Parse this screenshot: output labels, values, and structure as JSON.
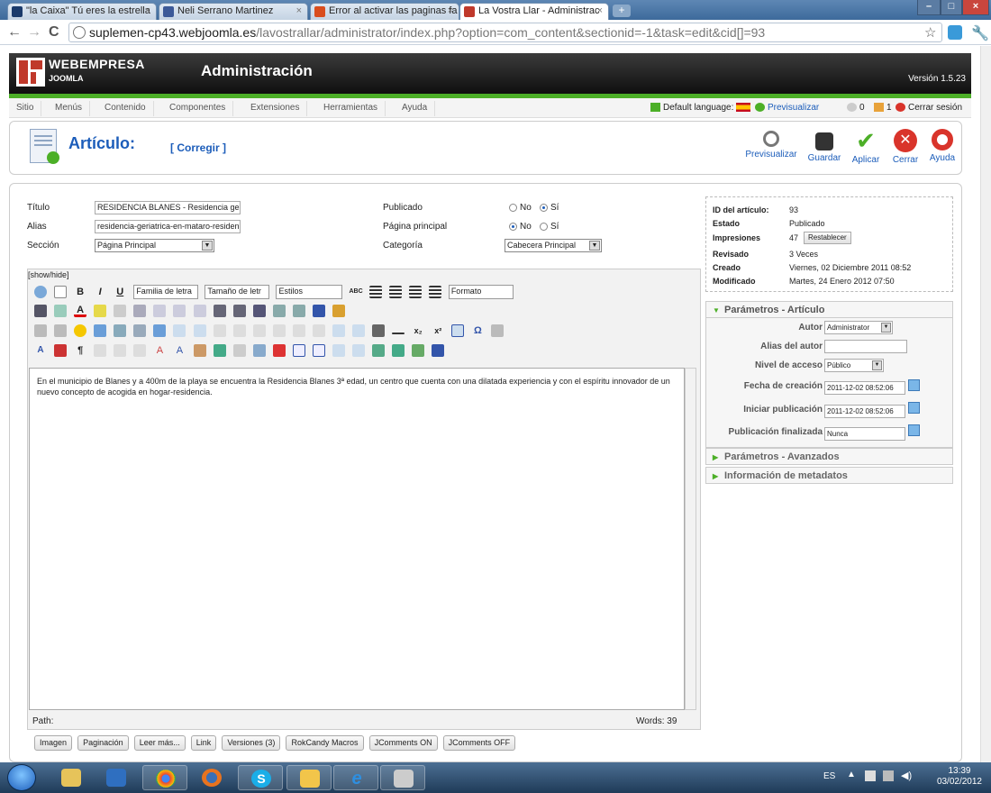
{
  "browser": {
    "tabs": [
      {
        "label": "\"la Caixa\" Tú eres la estrella",
        "color": "#1a3a6b"
      },
      {
        "label": "Neli Serrano Martinez",
        "color": "#3b5998"
      },
      {
        "label": "Error al activar las paginas fa",
        "color": "#d94d1e"
      },
      {
        "label": "La Vostra Llar - Administrac",
        "color": "#c0392b"
      }
    ],
    "url_host": "suplemen-cp43.webjoomla.es",
    "url_path": "/lavostrallar/administrator/index.php?option=com_content&sectionid=-1&task=edit&cid[]=93"
  },
  "header": {
    "brand": "WEBEMPRESA",
    "brand_sub": "JOOMLA",
    "title": "Administración",
    "version": "Versión 1.5.23"
  },
  "menu": [
    "Sitio",
    "Menús",
    "Contenido",
    "Componentes",
    "Extensiones",
    "Herramientas",
    "Ayuda"
  ],
  "status": {
    "language": "Default language:",
    "preview": "Previsualizar",
    "messages": "0",
    "users": "1",
    "logout": "Cerrar sesión"
  },
  "toolbar": {
    "title": "Artículo:",
    "subtitle": "[ Corregir ]",
    "buttons": [
      "Previsualizar",
      "Guardar",
      "Aplicar",
      "Cerrar",
      "Ayuda"
    ]
  },
  "form": {
    "title_label": "Título",
    "title_value": "RESIDENCIA BLANES - Residencia ger",
    "alias_label": "Alias",
    "alias_value": "residencia-geriatrica-en-mataro-residen",
    "section_label": "Sección",
    "section_value": "Página Principal",
    "published_label": "Publicado",
    "frontpage_label": "Página principal",
    "category_label": "Categoría",
    "category_value": "Cabecera Principal",
    "no": "No",
    "yes": "Sí",
    "published": "yes",
    "frontpage": "no"
  },
  "editor": {
    "showhide": "[show/hide]",
    "font_family": "Familia de letra",
    "font_size": "Tamaño de letr",
    "styles": "Estilos",
    "format": "Formato",
    "content": "En el municipio de Blanes y a 400m de la playa se encuentra la Residencia Blanes 3ª edad, un centro que cuenta con una dilatada experiencia y con el espíritu innovador de un nuevo concepto de acogida en hogar-residencia.",
    "path": "Path:",
    "words": "Words: 39",
    "buttons": [
      "Imagen",
      "Paginación",
      "Leer más...",
      "Link",
      "Versiones (3)",
      "RokCandy Macros",
      "JComments ON",
      "JComments OFF"
    ]
  },
  "info": {
    "rows": [
      {
        "label": "ID del artículo:",
        "value": "93"
      },
      {
        "label": "Estado",
        "value": "Publicado"
      },
      {
        "label": "Impresiones",
        "value": "47"
      },
      {
        "label": "Revisado",
        "value": "3 Veces"
      },
      {
        "label": "Creado",
        "value": "Viernes, 02 Diciembre 2011 08:52"
      },
      {
        "label": "Modificado",
        "value": "Martes, 24 Enero 2012 07:50"
      }
    ],
    "reset": "Restablecer"
  },
  "params": {
    "head": "Parámetros - Artículo",
    "author_label": "Autor",
    "author_value": "Administrator",
    "alias_label": "Alias del autor",
    "access_label": "Nivel de acceso",
    "access_value": "Público",
    "created_label": "Fecha de creación",
    "created_value": "2011-12-02 08:52:06",
    "start_label": "Iniciar publicación",
    "start_value": "2011-12-02 08:52:06",
    "end_label": "Publicación finalizada",
    "end_value": "Nunca",
    "advanced": "Parámetros - Avanzados",
    "metadata": "Información de metadatos"
  },
  "taskbar": {
    "lang": "ES",
    "time": "13:39",
    "date": "03/02/2012"
  }
}
